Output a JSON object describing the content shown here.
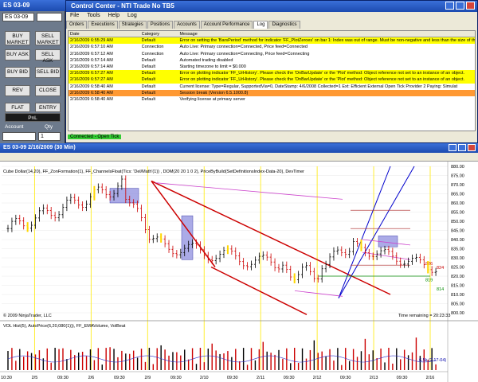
{
  "order_panel": {
    "title": "ES 03-09",
    "instrument_value": "ES 03-09",
    "buttons": [
      {
        "label": "BUY MARKET",
        "key": "buy-market"
      },
      {
        "label": "SELL MARKET",
        "key": "sell-market"
      },
      {
        "label": "BUY ASK",
        "key": "buy-ask"
      },
      {
        "label": "SELL ASK",
        "key": "sell-ask"
      },
      {
        "label": "BUY BID",
        "key": "buy-bid"
      },
      {
        "label": "SELL BID",
        "key": "sell-bid"
      },
      {
        "label": "REV",
        "key": "rev"
      },
      {
        "label": "CLOSE",
        "key": "close"
      },
      {
        "label": "FLAT",
        "key": "flat"
      },
      {
        "label": "ENTRY",
        "key": "entry"
      }
    ],
    "pnl_label": "PnL",
    "account_label": "Account",
    "qty_label": "Qty",
    "qty_value": "1"
  },
  "control_center": {
    "title": "Control Center - NTI Trade No TB5",
    "menu": [
      "File",
      "Tools",
      "Help",
      "Log"
    ],
    "tabs": [
      "Orders",
      "Executions",
      "Strategies",
      "Positions",
      "Accounts",
      "Account Performance",
      "Log",
      "Diagnostics"
    ],
    "active_tab": "Log",
    "columns": [
      "Date",
      "Category",
      "Message"
    ],
    "rows": [
      {
        "date": "2/16/2009 6:55:29 AM",
        "category": "Default",
        "message": "Error on setting the 'BarsPeriod' method for indicator 'FF_PlotZeroes' on bar 1: Index was out of range. Must be non-negative and less than the size of the collection.",
        "bg": "#ffff00"
      },
      {
        "date": "2/16/2009 6:57:10 AM",
        "category": "Connection",
        "message": "Auto Live: Primary connection=Connected, Price feed=Connected",
        "bg": "#ffffff"
      },
      {
        "date": "2/16/2009 6:57:12 AM",
        "category": "Connection",
        "message": "Auto Live: Primary connection=Connecting, Price feed=Connecting",
        "bg": "#ffffff"
      },
      {
        "date": "2/16/2009 6:57:14 AM",
        "category": "Default",
        "message": "Automated trading disabled",
        "bg": "#ffffff"
      },
      {
        "date": "2/16/2009 6:57:14 AM",
        "category": "Default",
        "message": "Starting timezone to limit = $0.000",
        "bg": "#ffffff"
      },
      {
        "date": "2/16/2009 6:57:27 AM",
        "category": "Default",
        "message": "Error on plotting indicator 'FF_UrHistory'. Please check the 'OnBarUpdate' or the 'Plot' method: Object reference not set to an instance of an object.",
        "bg": "#ffff00"
      },
      {
        "date": "2/16/2009 6:57:27 AM",
        "category": "Default",
        "message": "Error on plotting indicator 'FF_UrHistory'. Please check the 'OnBarUpdate' or the 'Plot' method: Object reference not set to an instance of an object.",
        "bg": "#ffff00"
      },
      {
        "date": "2/16/2009 6:58:40 AM",
        "category": "Default",
        "message": "Current license: Type=Regular, SupportedVia=0, DateStamp: 4/6/2008 Collected=1 Ext: Efficient External Open Tick Provider 2 Paying: Simulat",
        "bg": "#ffffff"
      },
      {
        "date": "2/16/2009 6:58:40 AM",
        "category": "Default",
        "message": "Session break (Version 6.5.1000.8)",
        "bg": "#ff9933"
      },
      {
        "date": "2/16/2009 6:58:40 AM",
        "category": "Default",
        "message": "Verifying license at primary server",
        "bg": "#ffffff"
      }
    ],
    "status_label": "Connected - Open Tick"
  },
  "chart_window": {
    "title": "ES 03-09   2/16/2009 (30 Min)",
    "indicator_legend": "Cube Dollar(14,20), FF_ZonFormation(1), FF_ChannelsFloat(Tics: 'Del/Math'(1)) , DOM(20 20 1 0 2), PriceByBuild(SetDefinitionsIndex-Data-20), DevTimer",
    "copyright": "© 2009 NinjaTrader, LLC",
    "time_remaining": "Time remaining = 20:23:33",
    "volume_legend": "VOL Hist(5), AutoPrice(6,20,080(1))), FF_EMAVolume, VolBeat",
    "volume_max_label": "6.5k (2.17-04)",
    "price_ticks": [
      "880.00",
      "875.00",
      "870.00",
      "865.00",
      "860.00",
      "855.00",
      "850.00",
      "845.00",
      "840.00",
      "835.00",
      "830.00",
      "825.00",
      "820.00",
      "815.00",
      "810.00",
      "805.00",
      "800.00"
    ],
    "time_labels": [
      "10:30",
      "2/5",
      "09:30",
      "2/6",
      "09:30",
      "2/9",
      "09:30",
      "2/10",
      "09:30",
      "2/11",
      "09:30",
      "2/12",
      "09:30",
      "2/13",
      "09:30",
      "2/16"
    ],
    "right_markers": [
      {
        "text": "826",
        "color": "#cc0000"
      },
      {
        "text": "824",
        "color": "#cc0000"
      },
      {
        "text": "819",
        "color": "#008800"
      },
      {
        "text": "814",
        "color": "#008800"
      }
    ],
    "colors": {
      "up_bar": "#000000",
      "down_bar": "#cc0000",
      "highlight_bar": "#ffd700",
      "channel": "#cc0000",
      "blue_channel": "#0000cc",
      "zone_box": "#8888dd",
      "purple_line": "#cc44cc"
    }
  }
}
